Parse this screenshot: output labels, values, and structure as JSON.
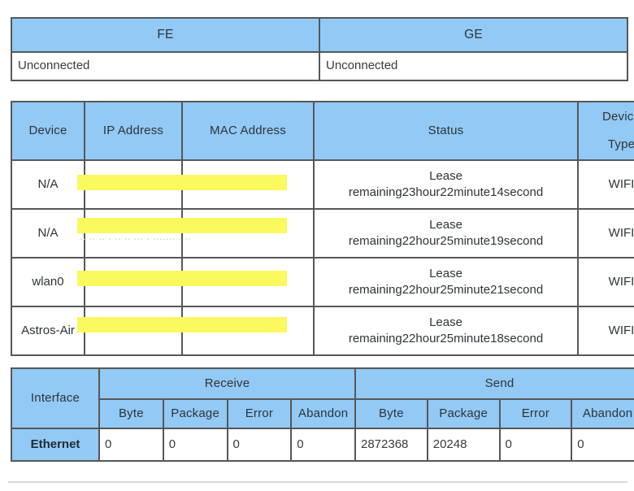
{
  "wan_table": {
    "headers": [
      "FE",
      "GE"
    ],
    "row": [
      "Unconnected",
      "Unconnected"
    ]
  },
  "device_table": {
    "headers": {
      "device": "Device",
      "ip_address": "IP Address",
      "mac_address": "MAC Address",
      "status": "Status",
      "device_type_line1": "Device",
      "device_type_line2": "Type"
    },
    "rows": [
      {
        "device": "N/A",
        "ip_address": "",
        "mac_address": "",
        "status_line1": "Lease",
        "status_line2": "remaining23hour22minute14second",
        "device_type": "WIFI",
        "redacted": true
      },
      {
        "device": "N/A",
        "ip_address": "",
        "mac_address": "",
        "status_line1": "Lease",
        "status_line2": "remaining22hour25minute19second",
        "device_type": "WIFI",
        "redacted": true
      },
      {
        "device": "wlan0",
        "ip_address": "",
        "mac_address": "",
        "status_line1": "Lease",
        "status_line2": "remaining22hour25minute21second",
        "device_type": "WIFI",
        "redacted": true
      },
      {
        "device": "Astros-Air",
        "ip_address": "",
        "mac_address": "",
        "status_line1": "Lease",
        "status_line2": "remaining22hour25minute18second",
        "device_type": "WIFI",
        "redacted": true
      }
    ]
  },
  "interface_table": {
    "headers": {
      "interface": "Interface",
      "receive": "Receive",
      "send": "Send",
      "byte": "Byte",
      "package": "Package",
      "error": "Error",
      "abandon": "Abandon"
    },
    "rows": [
      {
        "interface": "Ethernet",
        "receive_byte": "0",
        "receive_package": "0",
        "receive_error": "0",
        "receive_abandon": "0",
        "send_byte": "2872368",
        "send_package": "20248",
        "send_error": "0",
        "send_abandon": "0"
      }
    ]
  },
  "colors": {
    "header_blue": "#92c9f5",
    "redaction_yellow": "#faf95e",
    "border_gray": "#575757",
    "divider_gray": "#d9d9d9"
  }
}
